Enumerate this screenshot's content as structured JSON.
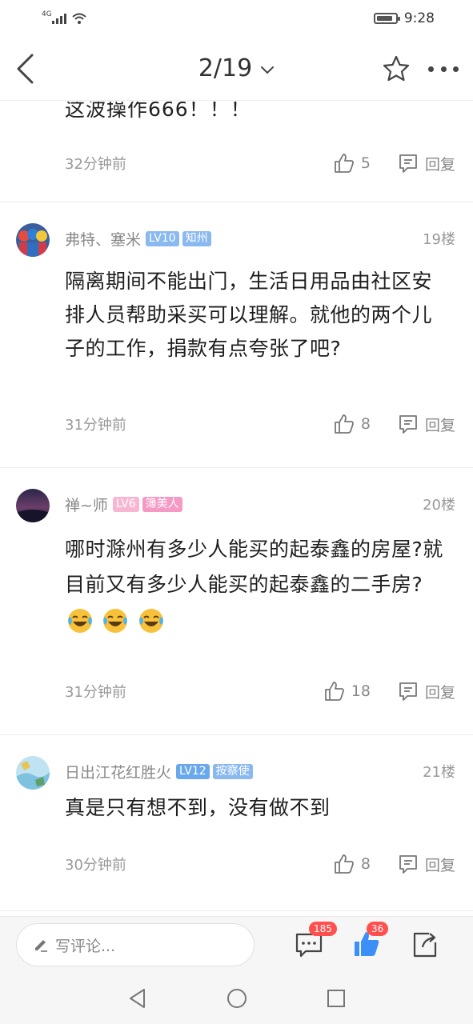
{
  "status": {
    "network": "4G",
    "time": "9:28",
    "battery_level": 0.85
  },
  "nav": {
    "page_indicator": "2/19"
  },
  "partial_comment": {
    "text": "这波操作666！！！",
    "time": "32分钟前",
    "likes": "5",
    "reply_label": "回复"
  },
  "comments": [
    {
      "username": "弗特、塞米",
      "level": "LV10",
      "tag": "知州",
      "floor": "19楼",
      "body": "隔离期间不能出门，生活日用品由社区安排人员帮助采买可以理解。就他的两个儿子的工作，捐款有点夸张了吧?",
      "time": "31分钟前",
      "likes": "8",
      "reply_label": "回复"
    },
    {
      "username": "禅~师",
      "level": "LV6",
      "tag": "簿美人",
      "floor": "20楼",
      "body": "哪时滁州有多少人能买的起泰鑫的房屋?就目前又有多少人能买的起泰鑫的二手房?",
      "emojis": [
        "laugh-cry-emoji",
        "laugh-cry-emoji",
        "laugh-cry-emoji"
      ],
      "time": "31分钟前",
      "likes": "18",
      "reply_label": "回复"
    },
    {
      "username": "日出江花红胜火",
      "level": "LV12",
      "tag": "按察使",
      "floor": "21楼",
      "body": "真是只有想不到，没有做不到",
      "time": "30分钟前",
      "likes": "8",
      "reply_label": "回复"
    }
  ],
  "bottom_bar": {
    "placeholder": "写评论...",
    "comment_count": "185",
    "like_count": "36"
  },
  "colors": {
    "accent_blue": "#3c8ff6",
    "badge_red": "#ff4f4f",
    "pink_tag": "#f59ac4"
  }
}
